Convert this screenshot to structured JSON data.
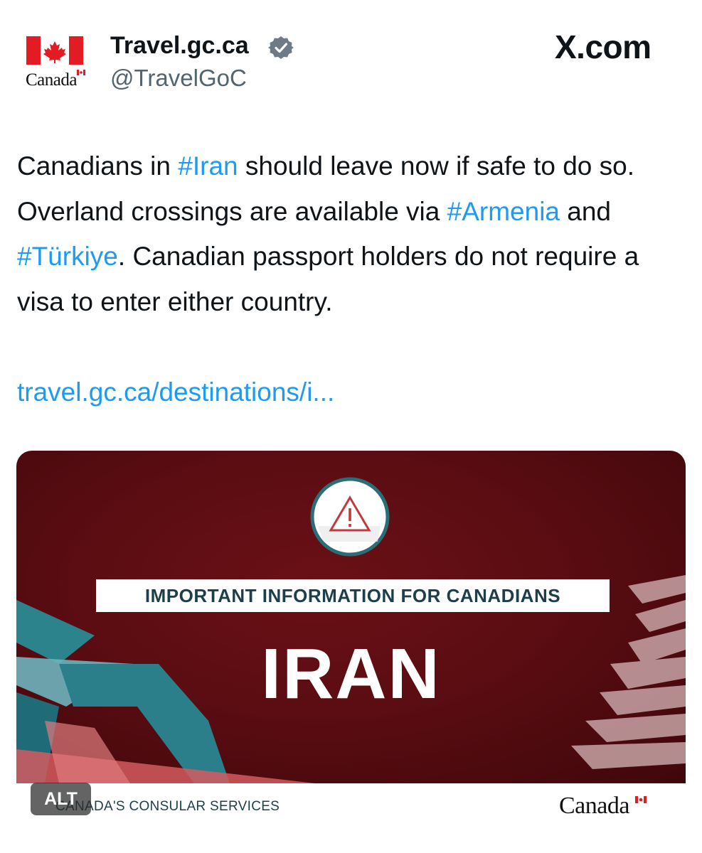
{
  "header": {
    "display_name": "Travel.gc.ca",
    "handle": "@TravelGoC",
    "logo_wordmark": "Canada",
    "site_label": "X.com"
  },
  "tweet": {
    "text_parts": [
      {
        "text": "Canadians in ",
        "hashtag": false
      },
      {
        "text": "#Iran",
        "hashtag": true
      },
      {
        "text": " should leave now if safe to do so. Overland crossings are available via ",
        "hashtag": false
      },
      {
        "text": "#Armenia",
        "hashtag": true
      },
      {
        "text": " and ",
        "hashtag": false
      },
      {
        "text": "#Türkiye",
        "hashtag": true
      },
      {
        "text": ". Canadian passport holders do not require a visa to enter either country.",
        "hashtag": false
      }
    ],
    "link": "travel.gc.ca/destinations/i..."
  },
  "media_card": {
    "banner": "IMPORTANT INFORMATION FOR CANADIANS",
    "country": "IRAN",
    "footer_left": "CANADA'S CONSULAR SERVICES",
    "footer_wordmark": "Canada",
    "alt_label": "ALT"
  },
  "colors": {
    "hashtag": "#1d9bf0",
    "card_red": "#5b0d12",
    "teal": "#2a8a94",
    "flag_red": "#e31b23"
  },
  "icons": {
    "verified": "verified-badge-icon",
    "warning": "warning-triangle-icon"
  }
}
